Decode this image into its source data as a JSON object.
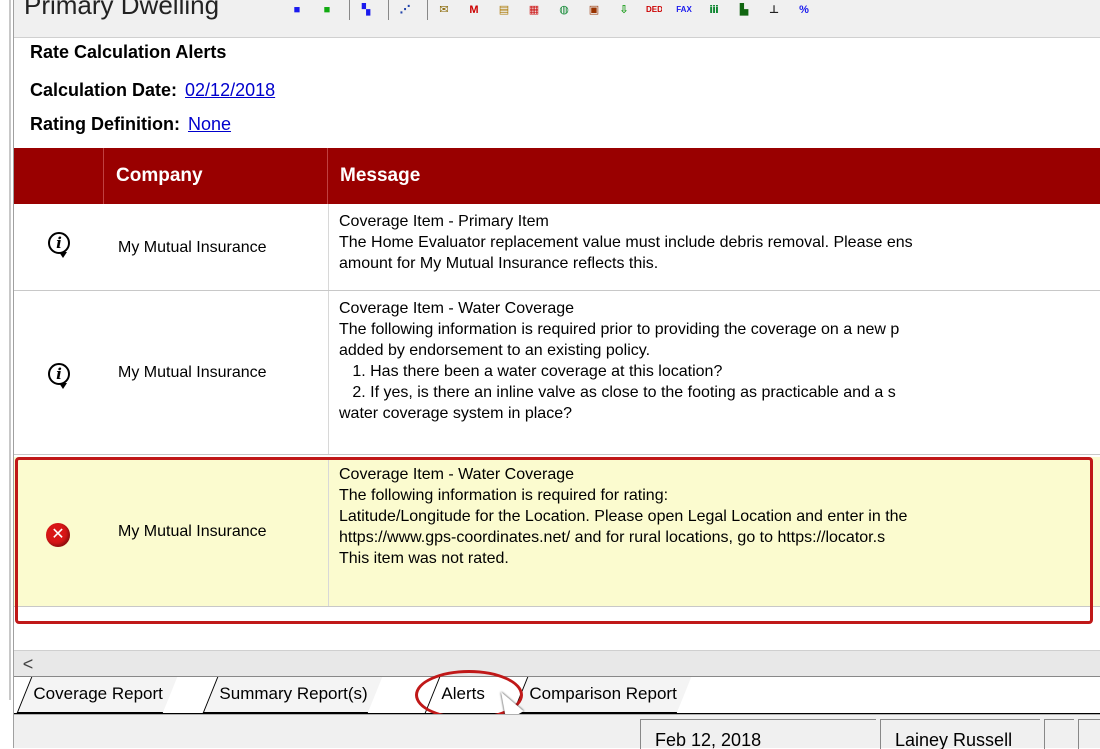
{
  "toolbar": {
    "title": "Primary Dwelling",
    "icons": [
      {
        "name": "blue-square-icon",
        "glyph": "■",
        "color": "#1a1aee"
      },
      {
        "name": "green-square-icon",
        "glyph": "■",
        "color": "#11aa11"
      },
      {
        "name": "grid-view-icon",
        "glyph": "▚",
        "color": "#1a1aee"
      },
      {
        "name": "cursor-select-icon",
        "glyph": "⋰",
        "color": "#2244aa"
      },
      {
        "name": "mail-icon",
        "glyph": "✉",
        "color": "#886600"
      },
      {
        "name": "m-icon",
        "glyph": "M",
        "color": "#cc0000"
      },
      {
        "name": "ruler-icon",
        "glyph": "▤",
        "color": "#aa7700"
      },
      {
        "name": "brick-icon",
        "glyph": "▦",
        "color": "#cc1111"
      },
      {
        "name": "globe-icon",
        "glyph": "◍",
        "color": "#118833"
      },
      {
        "name": "image-icon",
        "glyph": "▣",
        "color": "#993300"
      },
      {
        "name": "download-icon",
        "glyph": "⇩",
        "color": "#119911"
      },
      {
        "name": "ded-icon",
        "glyph": "DED",
        "color": "#cc0000"
      },
      {
        "name": "fax-icon",
        "glyph": "FAX",
        "color": "#1a1aee"
      },
      {
        "name": "tree-icon",
        "glyph": "ⅲ",
        "color": "#118833"
      },
      {
        "name": "building-icon",
        "glyph": "▙",
        "color": "#116611"
      },
      {
        "name": "chart-icon",
        "glyph": "⊥",
        "color": "#222222"
      },
      {
        "name": "percent-icon",
        "glyph": "%",
        "color": "#1a1aee"
      }
    ]
  },
  "header": {
    "section_title": "Rate Calculation Alerts",
    "calc_date_label": "Calculation Date:",
    "calc_date_value": "02/12/2018",
    "rating_def_label": "Rating Definition:",
    "rating_def_value": "None"
  },
  "grid": {
    "columns": [
      "",
      "Company",
      "Message"
    ],
    "rows": [
      {
        "type": "info",
        "company": "My Mutual Insurance",
        "lines": [
          "Coverage Item - Primary Item",
          "The Home Evaluator replacement value must include debris removal.  Please ens",
          "amount for My Mutual Insurance reflects this."
        ]
      },
      {
        "type": "info",
        "company": "My Mutual Insurance",
        "lines": [
          "Coverage Item - Water Coverage",
          "The following information is required prior to providing the coverage on a new p",
          "added by endorsement to an existing policy.",
          "   1. Has there been a water coverage at this location?",
          "   2. If yes, is there an inline valve as close to the footing as practicable and a s",
          "water coverage system in place?"
        ]
      },
      {
        "type": "error",
        "company": "My Mutual Insurance",
        "lines": [
          "Coverage Item - Water Coverage",
          "The following information is required for rating:",
          "Latitude/Longitude for the Location. Please open Legal Location and enter in the",
          "https://www.gps-coordinates.net/ and for rural locations, go to https://locator.s",
          "This item was not rated."
        ]
      }
    ]
  },
  "scrollbar": {
    "left_arrow": "<"
  },
  "tabs": [
    "Coverage Report",
    "Summary Report(s)",
    "Alerts",
    "Comparison Report"
  ],
  "active_tab": "Alerts",
  "statusbar": {
    "date": "Feb 12, 2018",
    "user": "Lainey Russell"
  }
}
